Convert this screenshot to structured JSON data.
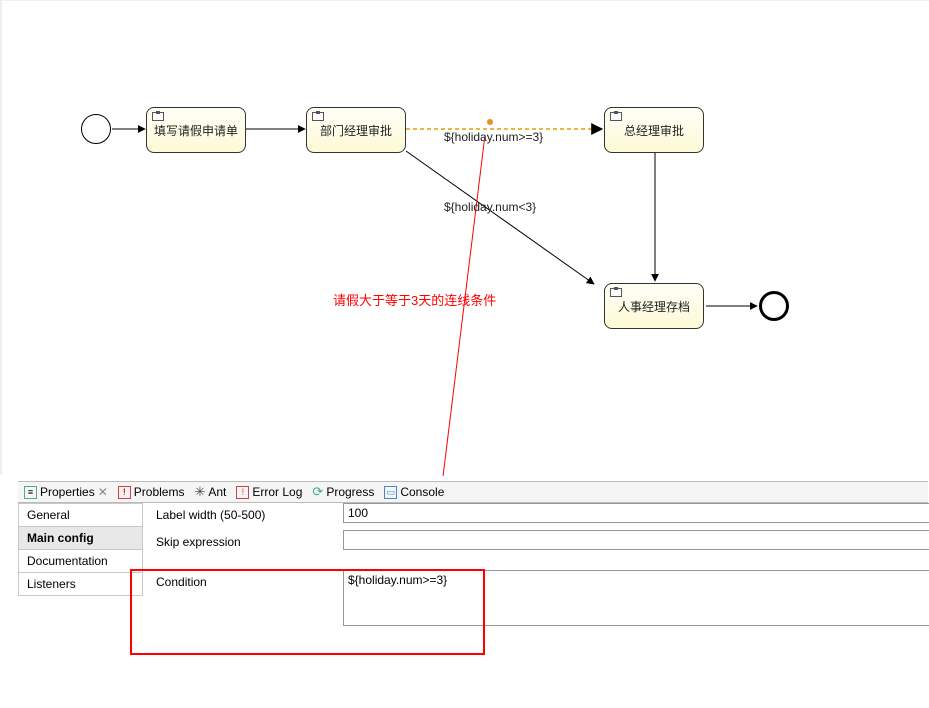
{
  "tasks": {
    "t1": "填写请假申请单",
    "t2": "部门经理审批",
    "t3": "总经理审批",
    "t4": "人事经理存档"
  },
  "edge_labels": {
    "e1": "${holiday.num>=3}",
    "e2": "${holiday.num<3}"
  },
  "annotation": "请假大于等于3天的连线条件",
  "tabs": {
    "properties": "Properties",
    "problems": "Problems",
    "ant": "Ant",
    "errorlog": "Error Log",
    "progress": "Progress",
    "console": "Console"
  },
  "side": {
    "general": "General",
    "main": "Main config",
    "doc": "Documentation",
    "listeners": "Listeners"
  },
  "form": {
    "label_width_label": "Label width (50-500)",
    "label_width_value": "100",
    "skip_label": "Skip expression",
    "skip_value": "",
    "condition_label": "Condition",
    "condition_value": "${holiday.num>=3}"
  }
}
